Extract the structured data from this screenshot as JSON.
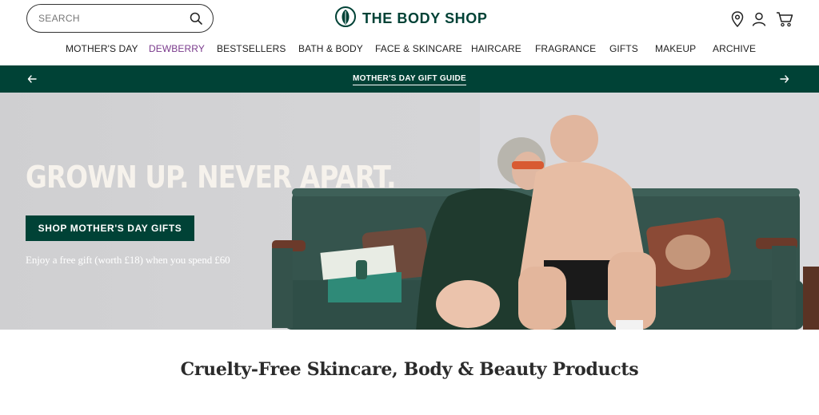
{
  "search": {
    "placeholder": "SEARCH",
    "icon": "search-icon"
  },
  "brand": {
    "name": "THE BODY SHOP",
    "color": "#004236",
    "icon": "leaf-logo-icon"
  },
  "utility_icons": [
    "store-locator-icon",
    "account-icon",
    "cart-icon"
  ],
  "nav": {
    "items": [
      {
        "label": "MOTHER'S DAY"
      },
      {
        "label": "DEWBERRY",
        "color": "#7a3a8c"
      },
      {
        "label": "BESTSELLERS"
      },
      {
        "label": "BATH & BODY"
      },
      {
        "label": "FACE & SKINCARE"
      },
      {
        "label": "HAIRCARE"
      },
      {
        "label": "FRAGRANCE"
      },
      {
        "label": "GIFTS"
      },
      {
        "label": "MAKEUP"
      },
      {
        "label": "ARCHIVE"
      }
    ]
  },
  "promo": {
    "text": "MOTHER'S DAY GIFT GUIDE",
    "background": "#004236",
    "prev_icon": "arrow-left-icon",
    "next_icon": "arrow-right-icon"
  },
  "hero": {
    "headline": "GROWN UP. NEVER APART.",
    "cta_label": "SHOP MOTHER'S DAY GIFTS",
    "subcopy": "Enjoy a free gift (worth £18) when you spend £60"
  },
  "section": {
    "heading": "Cruelty-Free Skincare, Body & Beauty Products"
  }
}
